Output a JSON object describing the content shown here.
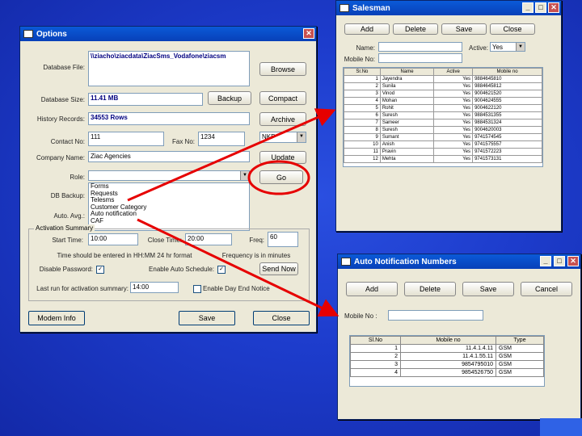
{
  "options": {
    "title": "Options",
    "labels": {
      "database_file": "Database File:",
      "database_size": "Database Size:",
      "history_records": "History Records:",
      "contact_no": "Contact No:",
      "fax_no": "Fax No:",
      "company_name": "Company Name:",
      "role": "Role:",
      "db_backup": "DB Backup:",
      "auto_avg": "Auto. Avg.:",
      "start_time": "Start Time:",
      "close_time": "Close Time:",
      "freq": "Freq:",
      "time_note": "Time should be entered in HH:MM 24 hr format",
      "freq_note": "Frequency is in minutes",
      "disable_password": "Disable Password:",
      "enable_auto_schedule": "Enable Auto Schedule:",
      "last_run": "Last run for activation summary:",
      "enable_day_end": "Enable Day End Notice"
    },
    "values": {
      "database_file": "\\\\ziacho\\ziacdata\\ZiacSms_Vodafone\\ziacsm",
      "database_size": "11.41 MB",
      "history_records": "34553 Rows",
      "contact_no": "111",
      "fax_no": "1234",
      "contact_right": "NKP",
      "company_name": "Ziac Agencies",
      "freq": "60",
      "start_time": "10:00",
      "close_time": "20:00",
      "last_run": "14:00"
    },
    "list_items": [
      "Forms",
      "Requests",
      "Telesms",
      "Customer Category",
      "Auto notification",
      "CAF"
    ],
    "group_title": "Activation Summary",
    "buttons": {
      "browse": "Browse",
      "backup": "Backup",
      "compact": "Compact",
      "archive": "Archive",
      "go": "Go",
      "update": "Update",
      "send_now": "Send Now",
      "modem_info": "Modem Info",
      "save": "Save",
      "close": "Close"
    }
  },
  "salesman": {
    "title": "Salesman",
    "toolbar": [
      "Add",
      "Delete",
      "Save",
      "Close"
    ],
    "labels": {
      "name": "Name:",
      "active": "Active:",
      "mobile_no": "Mobile No:"
    },
    "active_value": "Yes",
    "columns": [
      "Sr.No",
      "Name",
      "Active",
      "Mobile no"
    ],
    "rows": [
      [
        "1",
        "Jayendra",
        "Yes",
        "9884645810"
      ],
      [
        "2",
        "Sunila",
        "Yes",
        "9884645812"
      ],
      [
        "3",
        "Vinod",
        "Yes",
        "9004621520"
      ],
      [
        "4",
        "Mohan",
        "Yes",
        "9004624555"
      ],
      [
        "5",
        "Rohit",
        "Yes",
        "9004622120"
      ],
      [
        "6",
        "Suresh",
        "Yes",
        "9884531355"
      ],
      [
        "7",
        "Sameer",
        "Yes",
        "9884531324"
      ],
      [
        "8",
        "Suresh",
        "Yes",
        "9004620003"
      ],
      [
        "9",
        "Sumant",
        "Yes",
        "9741574545"
      ],
      [
        "10",
        "Anish",
        "Yes",
        "9741575557"
      ],
      [
        "11",
        "Pravin",
        "Yes",
        "9741572223"
      ],
      [
        "12",
        "Mehta",
        "Yes",
        "9741573131"
      ]
    ]
  },
  "auto_notification": {
    "title": "Auto Notification Numbers",
    "toolbar": [
      "Add",
      "Delete",
      "Save",
      "Cancel"
    ],
    "mobile_label": "Mobile No :",
    "columns": [
      "Sl.No",
      "Mobile no",
      "Type"
    ],
    "rows": [
      [
        "1",
        "11.4.1.4.11",
        "GSM"
      ],
      [
        "2",
        "11.4.1.55.11",
        "GSM"
      ],
      [
        "3",
        "9854795010",
        "GSM"
      ],
      [
        "4",
        "9854526750",
        "GSM"
      ]
    ]
  },
  "colors": {
    "arrow": "#e60000",
    "highlight": "#e60000",
    "titlebar": "#0a5ad8"
  }
}
